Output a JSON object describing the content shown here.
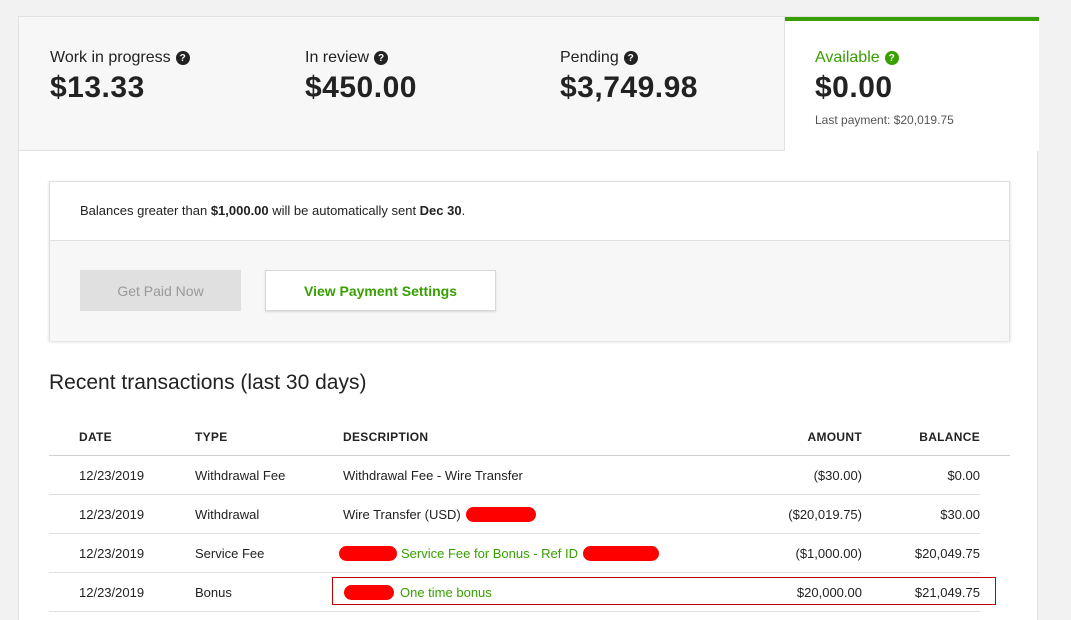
{
  "stats": {
    "work_in_progress": {
      "label": "Work in progress",
      "value": "$13.33"
    },
    "in_review": {
      "label": "In review",
      "value": "$450.00"
    },
    "pending": {
      "label": "Pending",
      "value": "$3,749.98"
    },
    "available": {
      "label": "Available",
      "value": "$0.00",
      "last_payment": "Last payment: $20,019.75"
    },
    "help_glyph": "?"
  },
  "notice": {
    "text_before": "Balances greater than ",
    "threshold": "$1,000.00",
    "text_middle": " will be automatically sent ",
    "date": "Dec 30",
    "text_after": "."
  },
  "buttons": {
    "get_paid_now": "Get Paid Now",
    "view_payment_settings": "View Payment Settings"
  },
  "transactions": {
    "title": "Recent transactions (last 30 days)",
    "columns": {
      "date": "DATE",
      "type": "TYPE",
      "description": "DESCRIPTION",
      "amount": "AMOUNT",
      "balance": "BALANCE"
    },
    "rows": [
      {
        "date": "12/23/2019",
        "type": "Withdrawal Fee",
        "description": "Withdrawal Fee - Wire Transfer",
        "amount": "($30.00)",
        "balance": "$0.00"
      },
      {
        "date": "12/23/2019",
        "type": "Withdrawal",
        "description": "Wire Transfer (USD)",
        "amount": "($20,019.75)",
        "balance": "$30.00"
      },
      {
        "date": "12/23/2019",
        "type": "Service Fee",
        "description": "Service Fee for Bonus - Ref ID",
        "amount": "($1,000.00)",
        "balance": "$20,049.75"
      },
      {
        "date": "12/23/2019",
        "type": "Bonus",
        "description": "One time bonus",
        "amount": "$20,000.00",
        "balance": "$21,049.75"
      }
    ]
  },
  "colors": {
    "accent_green": "#37a000",
    "redaction_red": "#ff0000",
    "highlight_box": "#c00000"
  }
}
